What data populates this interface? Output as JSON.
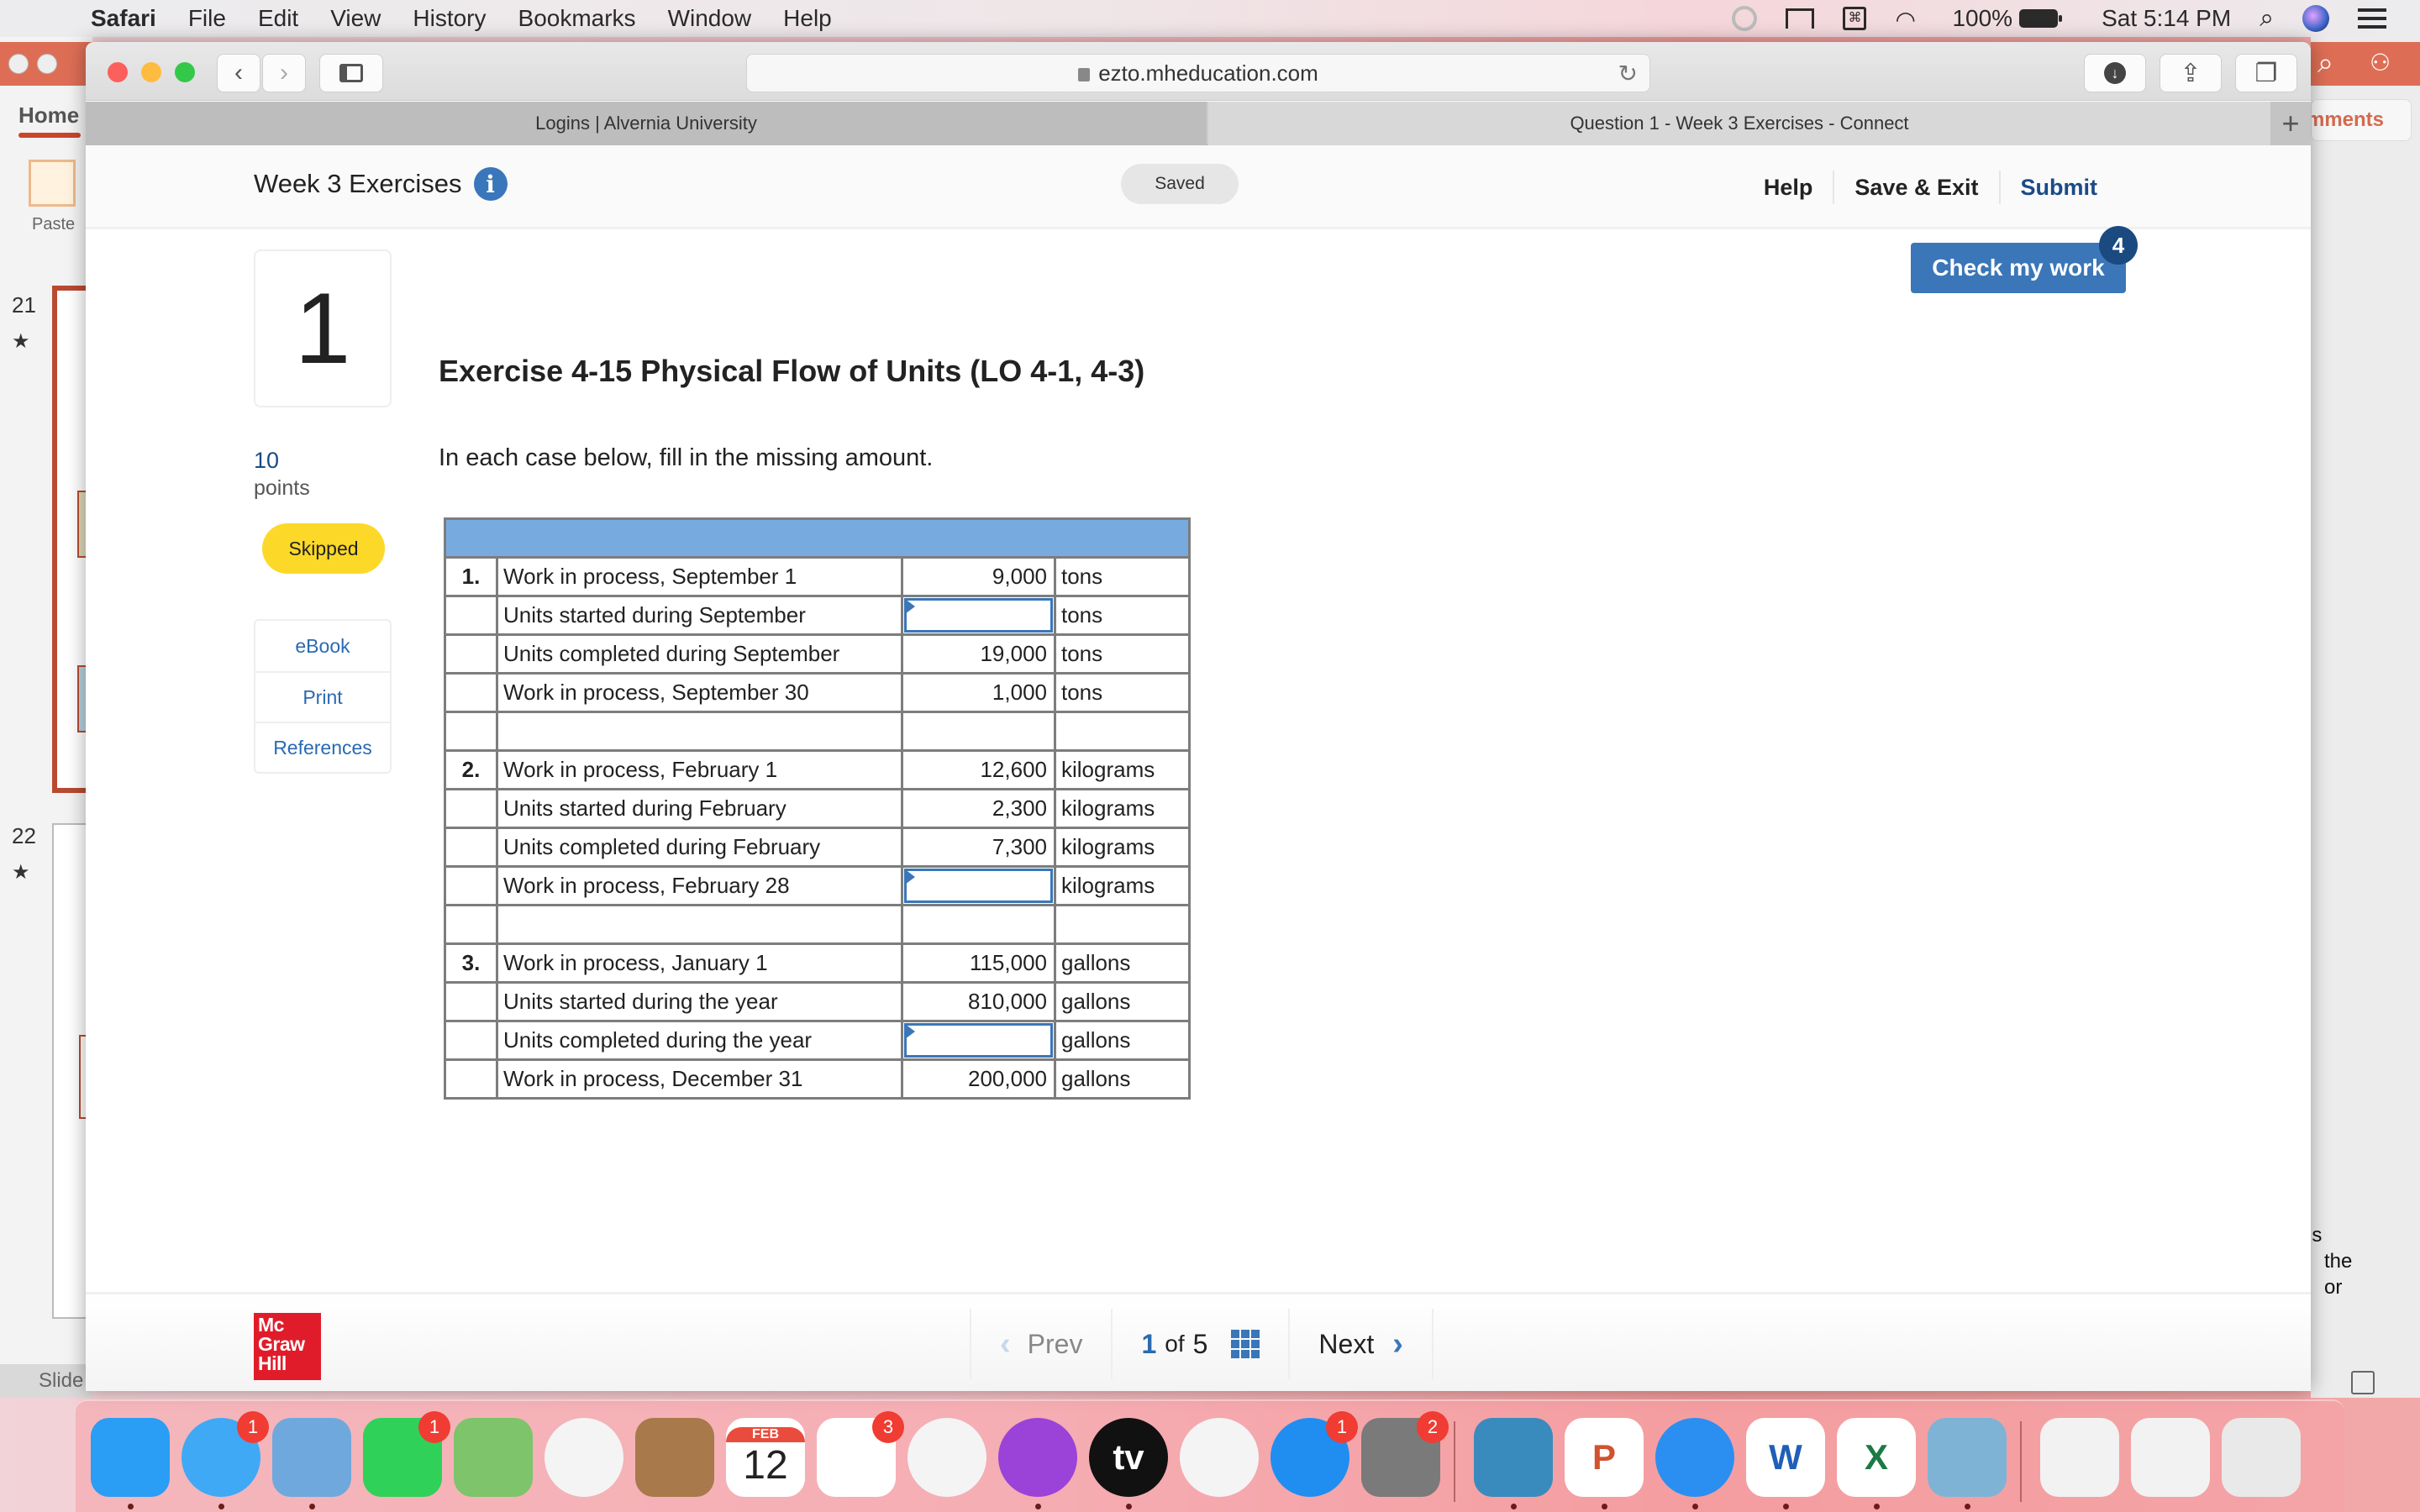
{
  "menubar": {
    "app_name": "Safari",
    "menus": [
      "File",
      "Edit",
      "View",
      "History",
      "Bookmarks",
      "Window",
      "Help"
    ],
    "battery": "100%",
    "clock": "Sat 5:14 PM"
  },
  "background_app": {
    "ribbon_tab": "Home",
    "paste_label": "Paste",
    "slides": [
      {
        "number": "21"
      },
      {
        "number": "22"
      }
    ],
    "status_label": "Slide",
    "comments_label": "Comments",
    "notes_fragment": [
      "is",
      "the",
      "or"
    ]
  },
  "browser": {
    "url": "ezto.mheducation.com",
    "tabs": [
      {
        "label": "Logins | Alvernia University",
        "active": false
      },
      {
        "label": "Question 1 - Week 3 Exercises - Connect",
        "active": true
      }
    ]
  },
  "assignment": {
    "title": "Week 3 Exercises",
    "saved_status": "Saved",
    "header_links": {
      "help": "Help",
      "save_exit": "Save & Exit",
      "submit": "Submit"
    },
    "check_my_work": {
      "label": "Check my work",
      "remaining": "4"
    }
  },
  "question": {
    "number": "1",
    "title": "Exercise 4-15 Physical Flow of Units (LO 4-1, 4-3)",
    "points_value": "10",
    "points_label": "points",
    "status": "Skipped",
    "instructions": "In each case below, fill in the missing amount.",
    "resources": [
      "eBook",
      "Print",
      "References"
    ],
    "table": {
      "rows": [
        {
          "num": "1.",
          "desc": "Work in process, September 1",
          "value": "9,000",
          "unit": "tons",
          "input": false
        },
        {
          "num": "",
          "desc": "Units started during September",
          "value": "",
          "unit": "tons",
          "input": true
        },
        {
          "num": "",
          "desc": "Units completed during September",
          "value": "19,000",
          "unit": "tons",
          "input": false
        },
        {
          "num": "",
          "desc": "Work in process, September 30",
          "value": "1,000",
          "unit": "tons",
          "input": false
        },
        {
          "num": "",
          "desc": "",
          "value": "",
          "unit": "",
          "input": false,
          "spacer": true
        },
        {
          "num": "2.",
          "desc": "Work in process, February 1",
          "value": "12,600",
          "unit": "kilograms",
          "input": false
        },
        {
          "num": "",
          "desc": "Units started during February",
          "value": "2,300",
          "unit": "kilograms",
          "input": false
        },
        {
          "num": "",
          "desc": "Units completed during February",
          "value": "7,300",
          "unit": "kilograms",
          "input": false
        },
        {
          "num": "",
          "desc": "Work in process, February 28",
          "value": "",
          "unit": "kilograms",
          "input": true
        },
        {
          "num": "",
          "desc": "",
          "value": "",
          "unit": "",
          "input": false,
          "spacer": true
        },
        {
          "num": "3.",
          "desc": "Work in process, January 1",
          "value": "115,000",
          "unit": "gallons",
          "input": false
        },
        {
          "num": "",
          "desc": "Units started during the year",
          "value": "810,000",
          "unit": "gallons",
          "input": false
        },
        {
          "num": "",
          "desc": "Units completed during the year",
          "value": "",
          "unit": "gallons",
          "input": true
        },
        {
          "num": "",
          "desc": "Work in process, December 31",
          "value": "200,000",
          "unit": "gallons",
          "input": false
        }
      ]
    }
  },
  "footer": {
    "logo_lines": [
      "Mc",
      "Graw",
      "Hill"
    ],
    "prev_label": "Prev",
    "current_page": "1",
    "of_label": "of",
    "total_pages": "5",
    "next_label": "Next"
  },
  "dock": {
    "apps": [
      {
        "name": "Finder",
        "badge": ""
      },
      {
        "name": "Messages",
        "badge": "1"
      },
      {
        "name": "Mail",
        "badge": ""
      },
      {
        "name": "FaceTime",
        "badge": "1"
      },
      {
        "name": "Maps",
        "badge": ""
      },
      {
        "name": "Photos",
        "badge": ""
      },
      {
        "name": "Contacts",
        "badge": ""
      },
      {
        "name": "Calendar",
        "badge": "",
        "month": "FEB",
        "day": "12"
      },
      {
        "name": "Reminders",
        "badge": "3"
      },
      {
        "name": "Music",
        "badge": ""
      },
      {
        "name": "Podcasts",
        "badge": ""
      },
      {
        "name": "TV",
        "badge": "",
        "glyph": "tv"
      },
      {
        "name": "News",
        "badge": ""
      },
      {
        "name": "App Store",
        "badge": "1"
      },
      {
        "name": "System Preferences",
        "badge": "2"
      },
      {
        "name": "Kindle",
        "badge": ""
      },
      {
        "name": "PowerPoint",
        "badge": "",
        "glyph": "P"
      },
      {
        "name": "Safari",
        "badge": ""
      },
      {
        "name": "Word",
        "badge": "",
        "glyph": "W"
      },
      {
        "name": "Excel",
        "badge": "",
        "glyph": "X"
      },
      {
        "name": "Preview",
        "badge": ""
      },
      {
        "name": "Recent Window 1",
        "badge": ""
      },
      {
        "name": "Recent Window 2",
        "badge": ""
      },
      {
        "name": "Trash",
        "badge": ""
      }
    ]
  }
}
